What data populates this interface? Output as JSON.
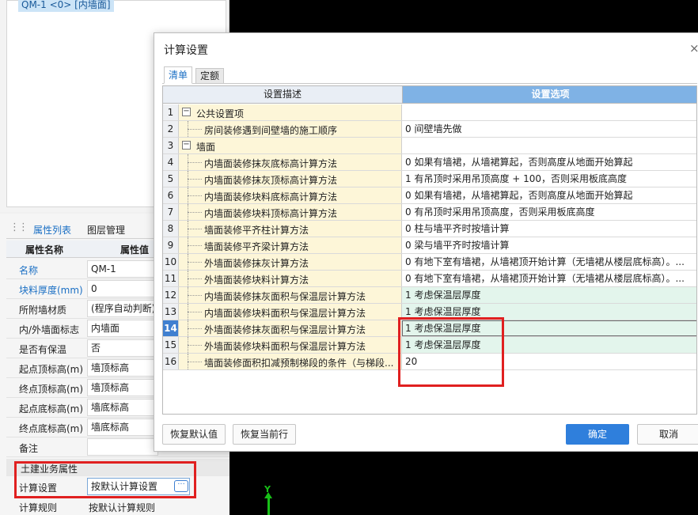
{
  "tree": {
    "selected_item": "QM-1 <0> [内墙面]"
  },
  "canvas": {
    "axis_label": "Y"
  },
  "props_panel": {
    "tabs": [
      "属性列表",
      "图层管理"
    ],
    "header": {
      "name": "属性名称",
      "value": "属性值"
    },
    "rows": [
      {
        "name": "名称",
        "value": "QM-1",
        "blue": true
      },
      {
        "name": "块料厚度(mm)",
        "value": "0",
        "blue": true
      },
      {
        "name": "所附墙材质",
        "value": "(程序自动判断)",
        "blue": false
      },
      {
        "name": "内/外墙面标志",
        "value": "内墙面",
        "blue": false
      },
      {
        "name": "是否有保温",
        "value": "否",
        "blue": false
      },
      {
        "name": "起点顶标高(m)",
        "value": "墙顶标高",
        "blue": false
      },
      {
        "name": "终点顶标高(m)",
        "value": "墙顶标高",
        "blue": false
      },
      {
        "name": "起点底标高(m)",
        "value": "墙底标高",
        "blue": false
      },
      {
        "name": "终点底标高(m)",
        "value": "墙底标高",
        "blue": false
      },
      {
        "name": "备注",
        "value": "",
        "blue": false
      }
    ],
    "group_label": "土建业务属性",
    "calc_setting": {
      "name": "计算设置",
      "value": "按默认计算设置",
      "button": "···"
    },
    "calc_rule": {
      "name": "计算规则",
      "value": "按默认计算规则"
    }
  },
  "dialog": {
    "title": "计算设置",
    "close_icon": "×",
    "tabs": [
      "清单",
      "定额"
    ],
    "columns": [
      "设置描述",
      "设置选项"
    ],
    "rows": [
      {
        "n": "1",
        "desc": "公共设置项",
        "value": "",
        "group": true,
        "sign": "−"
      },
      {
        "n": "2",
        "desc": "房间装修遇到间壁墙的施工顺序",
        "value": "0 间壁墙先做",
        "group": false
      },
      {
        "n": "3",
        "desc": "墙面",
        "value": "",
        "group": true,
        "sign": "−"
      },
      {
        "n": "4",
        "desc": "内墙面装修抹灰底标高计算方法",
        "value": "0 如果有墙裙，从墙裙算起，否则高度从地面开始算起",
        "group": false
      },
      {
        "n": "5",
        "desc": "内墙面装修抹灰顶标高计算方法",
        "value": "1 有吊顶时采用吊顶高度 + 100，否则采用板底高度",
        "group": false
      },
      {
        "n": "6",
        "desc": "内墙面装修块料底标高计算方法",
        "value": "0 如果有墙裙，从墙裙算起，否则高度从地面开始算起",
        "group": false
      },
      {
        "n": "7",
        "desc": "内墙面装修块料顶标高计算方法",
        "value": "0 有吊顶时采用吊顶高度，否则采用板底高度",
        "group": false
      },
      {
        "n": "8",
        "desc": "墙面装修平齐柱计算方法",
        "value": "0 柱与墙平齐时按墙计算",
        "group": false
      },
      {
        "n": "9",
        "desc": "墙面装修平齐梁计算方法",
        "value": "0 梁与墙平齐时按墙计算",
        "group": false
      },
      {
        "n": "10",
        "desc": "外墙面装修抹灰计算方法",
        "value": "0 有地下室有墙裙，从墙裙顶开始计算（无墙裙从楼层底标高）。...",
        "group": false
      },
      {
        "n": "11",
        "desc": "外墙面装修块料计算方法",
        "value": "0 有地下室有墙裙，从墙裙顶开始计算（无墙裙从楼层底标高）。...",
        "group": false
      },
      {
        "n": "12",
        "desc": "内墙面装修抹灰面积与保温层计算方法",
        "value": "1 考虑保温层厚度",
        "group": false,
        "green": true
      },
      {
        "n": "13",
        "desc": "内墙面装修块料面积与保温层计算方法",
        "value": "1 考虑保温层厚度",
        "group": false,
        "green": true
      },
      {
        "n": "14",
        "desc": "外墙面装修抹灰面积与保温层计算方法",
        "value": "1 考虑保温层厚度",
        "group": false,
        "green": true,
        "selected": true
      },
      {
        "n": "15",
        "desc": "外墙面装修块料面积与保温层计算方法",
        "value": "1 考虑保温层厚度",
        "group": false,
        "green": true
      },
      {
        "n": "16",
        "desc": "墙面装修面积扣减预制梯段的条件（与梯段...",
        "value": "20",
        "group": false
      }
    ],
    "buttons": {
      "restore_default": "恢复默认值",
      "restore_row": "恢复当前行",
      "ok": "确定",
      "cancel": "取消"
    }
  }
}
